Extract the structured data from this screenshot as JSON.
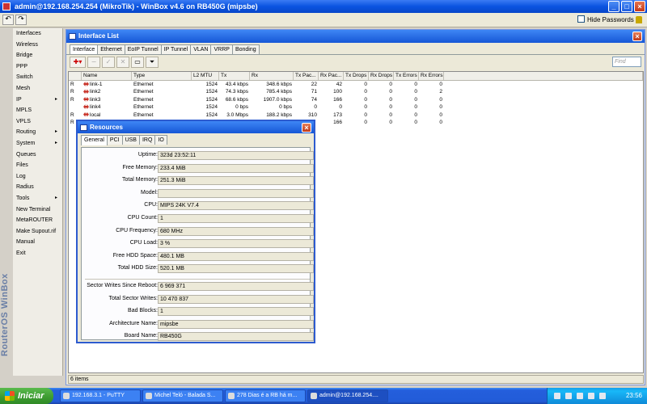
{
  "window_title": "admin@192.168.254.254 (MikroTik) - WinBox v4.6 on RB450G (mipsbe)",
  "toolbar": {
    "hide_passwords": "Hide Passwords",
    "undo": "↶",
    "redo": "↷"
  },
  "brand": "RouterOS WinBox",
  "menu": [
    {
      "label": "Interfaces"
    },
    {
      "label": "Wireless"
    },
    {
      "label": "Bridge"
    },
    {
      "label": "PPP"
    },
    {
      "label": "Switch"
    },
    {
      "label": "Mesh"
    },
    {
      "label": "IP",
      "arrow": "▸"
    },
    {
      "label": "MPLS"
    },
    {
      "label": "VPLS"
    },
    {
      "label": "Routing",
      "arrow": "▸"
    },
    {
      "label": "System",
      "arrow": "▸"
    },
    {
      "label": "Queues"
    },
    {
      "label": "Files"
    },
    {
      "label": "Log"
    },
    {
      "label": "Radius"
    },
    {
      "label": "Tools",
      "arrow": "▸"
    },
    {
      "label": "New Terminal"
    },
    {
      "label": "MetaROUTER"
    },
    {
      "label": "Make Supout.rif"
    },
    {
      "label": "Manual"
    },
    {
      "label": "Exit"
    }
  ],
  "interface_list": {
    "title": "Interface List",
    "tabs": [
      "Interface",
      "Ethernet",
      "EoIP Tunnel",
      "IP Tunnel",
      "VLAN",
      "VRRP",
      "Bonding"
    ],
    "find_placeholder": "Find",
    "columns": [
      "",
      "Name",
      "Type",
      "L2 MTU",
      "Tx",
      "Rx",
      "Tx Pac...",
      "Rx Pac...",
      "Tx Drops",
      "Rx Drops",
      "Tx Errors",
      "Rx Errors"
    ],
    "rows": [
      {
        "flag": "R",
        "name": "link-1",
        "type": "Ethernet",
        "mtu": "1524",
        "tx": "43.4 kbps",
        "rx": "348.6 kbps",
        "txp": "22",
        "rxp": "42",
        "txd": "0",
        "rxd": "0",
        "txe": "0",
        "rxe": "0"
      },
      {
        "flag": "R",
        "name": "link2",
        "type": "Ethernet",
        "mtu": "1524",
        "tx": "74.3 kbps",
        "rx": "785.4 kbps",
        "txp": "71",
        "rxp": "100",
        "txd": "0",
        "rxd": "0",
        "txe": "0",
        "rxe": "2"
      },
      {
        "flag": "R",
        "name": "link3",
        "type": "Ethernet",
        "mtu": "1524",
        "tx": "68.6 kbps",
        "rx": "1907.0 kbps",
        "txp": "74",
        "rxp": "166",
        "txd": "0",
        "rxd": "0",
        "txe": "0",
        "rxe": "0"
      },
      {
        "flag": "",
        "name": "link4",
        "type": "Ethernet",
        "mtu": "1524",
        "tx": "0 bps",
        "rx": "0 bps",
        "txp": "0",
        "rxp": "0",
        "txd": "0",
        "rxd": "0",
        "txe": "0",
        "rxe": "0"
      },
      {
        "flag": "R",
        "name": "local",
        "type": "Ethernet",
        "mtu": "1524",
        "tx": "3.0 Mbps",
        "rx": "188.2 kbps",
        "txp": "310",
        "rxp": "173",
        "txd": "0",
        "rxd": "0",
        "txe": "0",
        "rxe": "0"
      },
      {
        "flag": "R",
        "name": "",
        "type": "",
        "mtu": "",
        "tx": "",
        "rx": "",
        "txp": "",
        "rxp": "166",
        "txd": "0",
        "rxd": "0",
        "txe": "0",
        "rxe": "0"
      }
    ],
    "status": "6 items"
  },
  "resources": {
    "title": "Resources",
    "tabs": [
      "General",
      "PCI",
      "USB",
      "IRQ",
      "IO"
    ],
    "fields": [
      {
        "label": "Uptime:",
        "value": "323d 23:52:11"
      },
      {
        "label": "Free Memory:",
        "value": "233.4 MiB"
      },
      {
        "label": "Total Memory:",
        "value": "251.3 MiB"
      },
      {
        "label": "Model:",
        "value": ""
      },
      {
        "label": "CPU:",
        "value": "MIPS 24K V7.4"
      },
      {
        "label": "CPU Count:",
        "value": "1"
      },
      {
        "label": "CPU Frequency:",
        "value": "680 MHz"
      },
      {
        "label": "CPU Load:",
        "value": "3 %"
      },
      {
        "label": "Free HDD Space:",
        "value": "480.1 MB"
      },
      {
        "label": "Total HDD Size:",
        "value": "520.1 MB"
      },
      {
        "label": "Sector Writes Since Reboot:",
        "value": "6 969 371"
      },
      {
        "label": "Total Sector Writes:",
        "value": "10 470 837"
      },
      {
        "label": "Bad Blocks:",
        "value": "1"
      },
      {
        "label": "Architecture Name:",
        "value": "mipsbe"
      },
      {
        "label": "Board Name:",
        "value": "RB450G"
      }
    ]
  },
  "taskbar": {
    "start": "Iniciar",
    "items": [
      "192.168.3.1 - PuTTY",
      "Michel Teló - Balada S...",
      "278 Dias é a RB há m...",
      "admin@192.168.254...."
    ],
    "clock": "23:56"
  }
}
